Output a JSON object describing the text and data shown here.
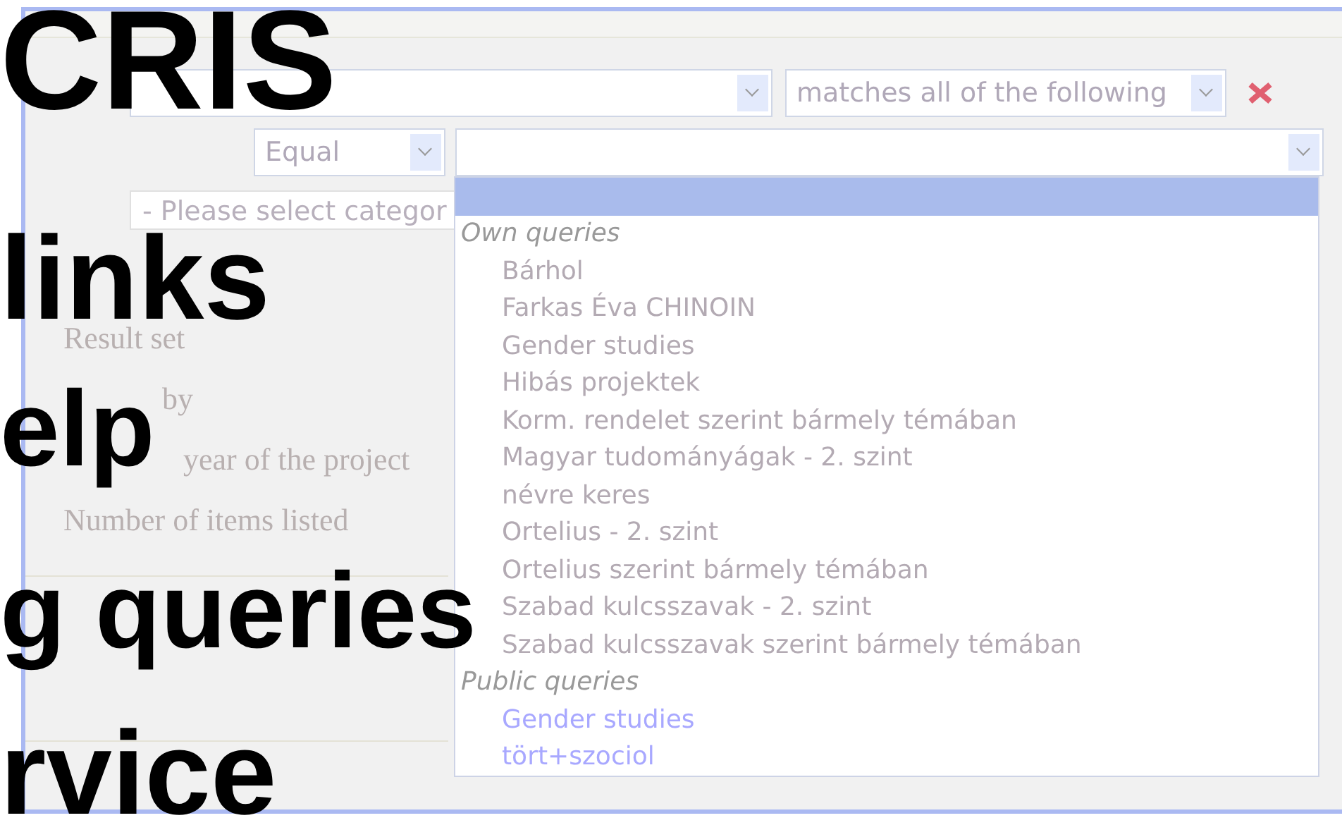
{
  "overlay_titles": [
    "CRIS",
    "links",
    "elp",
    "g queries",
    "rvice"
  ],
  "condition_row": {
    "operator_select": {
      "value": "matches all of the following"
    }
  },
  "criterion_row": {
    "operator_select": {
      "value": "Equal"
    }
  },
  "category_select": {
    "value": "- Please select categor"
  },
  "labels": [
    "Result set",
    "by",
    "year of the project",
    "Number of items listed"
  ],
  "query_dropdown": {
    "blank_option": {
      "selected": true
    },
    "groups": [
      {
        "kind": "own",
        "label": "Own queries",
        "options": [
          {
            "label": "Bárhol",
            "selected": false
          },
          {
            "label": "Farkas Éva CHINOIN",
            "selected": false
          },
          {
            "label": "Gender studies",
            "selected": false
          },
          {
            "label": "Hibás projektek",
            "selected": false
          },
          {
            "label": "Korm. rendelet szerint bármely témában",
            "selected": false
          },
          {
            "label": "Magyar tudományágak - 2. szint",
            "selected": false
          },
          {
            "label": "névre keres",
            "selected": false
          },
          {
            "label": "Ortelius - 2. szint",
            "selected": false
          },
          {
            "label": "Ortelius szerint bármely témában",
            "selected": false
          },
          {
            "label": "Szabad kulcsszavak - 2. szint",
            "selected": false
          },
          {
            "label": "Szabad kulcsszavak szerint bármely témában",
            "selected": false
          }
        ]
      },
      {
        "kind": "public",
        "label": "Public queries",
        "options": [
          {
            "label": "Gender studies",
            "selected": false
          },
          {
            "label": "tört+szociol",
            "selected": false
          }
        ]
      }
    ]
  }
}
